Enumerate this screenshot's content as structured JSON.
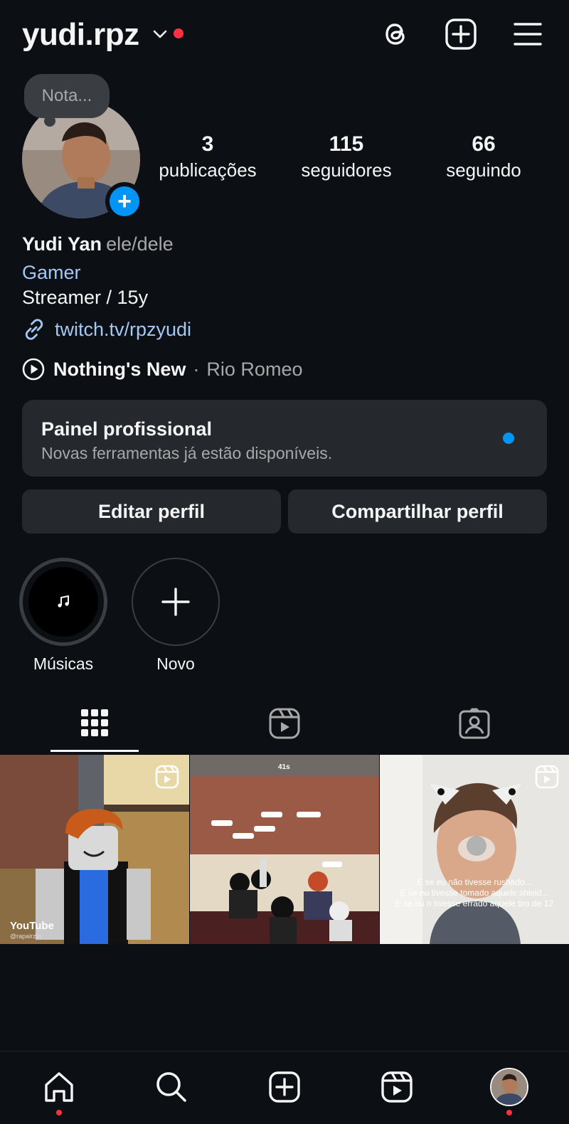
{
  "header": {
    "username": "yudi.rpz",
    "icons": [
      "chevron-down-icon",
      "threads-icon",
      "new-post-icon",
      "menu-icon"
    ],
    "notification_color": "#ff3040"
  },
  "note": {
    "placeholder": "Nota..."
  },
  "stats": [
    {
      "value": "3",
      "label": "publicações"
    },
    {
      "value": "115",
      "label": "seguidores"
    },
    {
      "value": "66",
      "label": "seguindo"
    }
  ],
  "profile": {
    "name": "Yudi Yan",
    "pronouns": "ele/dele",
    "category": "Gamer",
    "bio": "Streamer / 15y",
    "link": "twitch.tv/rpzyudi"
  },
  "music": {
    "title": "Nothing's New",
    "separator": "·",
    "artist": "Rio Romeo"
  },
  "dashboard": {
    "title": "Painel profissional",
    "subtitle": "Novas ferramentas já estão disponíveis."
  },
  "buttons": {
    "edit": "Editar perfil",
    "share": "Compartilhar perfil"
  },
  "highlights": [
    {
      "label": "Músicas",
      "icon": "music-note-icon"
    },
    {
      "label": "Novo",
      "icon": "plus-icon"
    }
  ],
  "tabs": [
    {
      "icon": "grid-icon",
      "active": true
    },
    {
      "icon": "reels-icon",
      "active": false
    },
    {
      "icon": "tagged-icon",
      "active": false
    }
  ],
  "posts": [
    {
      "type": "reel",
      "overlay": [
        "YouTube",
        "@rapairzin"
      ]
    },
    {
      "type": "image",
      "overlay": [
        "41s"
      ]
    },
    {
      "type": "reel",
      "overlay": [
        "E se eu não tivesse rushado...",
        "E se eu tivesse tomado aquele shield...",
        "E se eu n tivesse errado aquele tiro de 12"
      ]
    }
  ],
  "bottom_nav": [
    "home-icon",
    "search-icon",
    "create-icon",
    "reels-icon",
    "profile-avatar"
  ],
  "colors": {
    "background": "#0c1014",
    "accent": "#0095f6",
    "link": "#a4c8f5",
    "button_bg": "#25292e"
  }
}
